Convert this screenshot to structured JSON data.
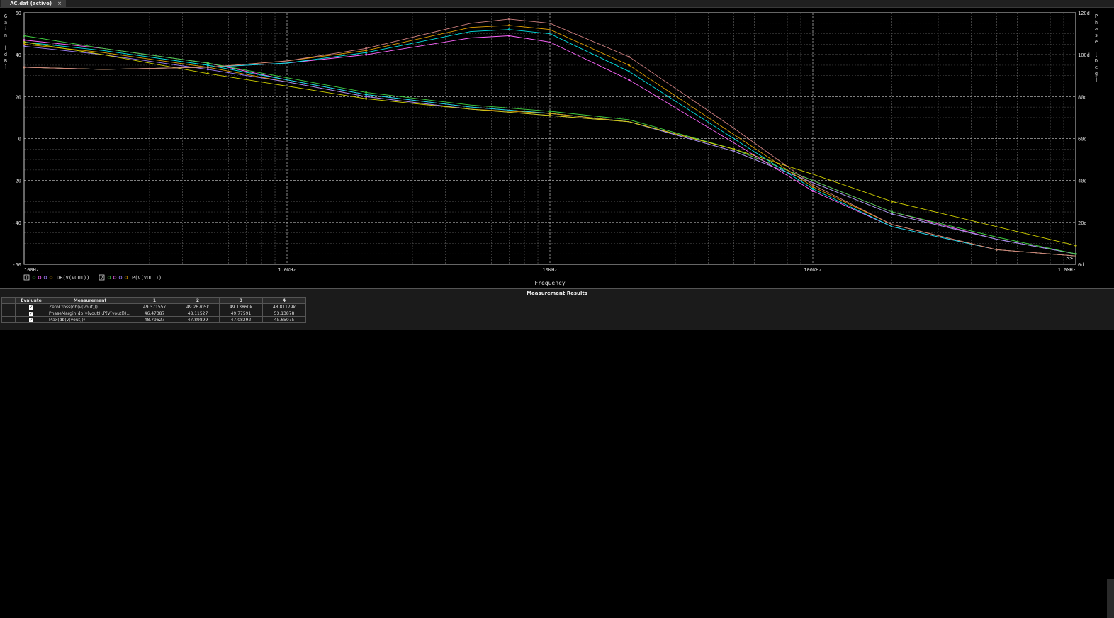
{
  "tab": {
    "title": "AC.dat (active)",
    "close": "×"
  },
  "chart_data": {
    "type": "line",
    "xscale": "log",
    "xlim": [
      100,
      1000000
    ],
    "x_ticks": [
      "100Hz",
      "1.0KHz",
      "10KHz",
      "100KHz",
      "1.0MHz"
    ],
    "x_tick_values": [
      100,
      1000,
      10000,
      100000,
      1000000
    ],
    "xlabel": "Frequency",
    "ylabel_left": "Gain [dB]",
    "ylim_left": [
      -60,
      60
    ],
    "y_ticks_left": [
      "60",
      "40",
      "20",
      "0",
      "-20",
      "-40",
      "-60"
    ],
    "ylabel_right": "Phase [Deg]",
    "ylim_right": [
      0,
      120
    ],
    "y_ticks_right": [
      "120d",
      "100d",
      "80d",
      "60d",
      "40d",
      "20d",
      "0d"
    ],
    "grid": true,
    "legend": [
      {
        "box": "1",
        "label": "DB(V(VOUT))"
      },
      {
        "box": "2",
        "label": "P(V(VOUT))"
      }
    ],
    "overflow_marker": ">>",
    "series": [
      {
        "axis": "left",
        "color": "#ff66ff",
        "x": [
          100,
          200,
          500,
          1000,
          2000,
          5000,
          10000,
          20000,
          50000,
          100000,
          200000,
          500000,
          1000000
        ],
        "y": [
          47,
          43,
          36,
          28,
          21,
          15,
          12,
          8,
          -5,
          -20,
          -35,
          -48,
          -55
        ]
      },
      {
        "axis": "left",
        "color": "#00e5e5",
        "x": [
          100,
          200,
          500,
          1000,
          2000,
          5000,
          10000,
          20000,
          50000,
          100000,
          200000,
          500000,
          1000000
        ],
        "y": [
          46,
          42,
          35,
          28,
          21,
          15,
          12,
          8,
          -6,
          -21,
          -36,
          -48,
          -55
        ]
      },
      {
        "axis": "left",
        "color": "#e0a000",
        "x": [
          100,
          200,
          500,
          1000,
          2000,
          5000,
          10000,
          20000,
          50000,
          100000,
          200000,
          500000,
          1000000
        ],
        "y": [
          45,
          41,
          34,
          27,
          20,
          14,
          12,
          8,
          -6,
          -21,
          -36,
          -48,
          -55
        ]
      },
      {
        "axis": "left",
        "color": "#a080ff",
        "x": [
          100,
          200,
          500,
          1000,
          2000,
          5000,
          10000,
          20000,
          50000,
          100000,
          200000,
          500000,
          1000000
        ],
        "y": [
          44,
          40,
          33,
          27,
          20,
          14,
          11,
          8,
          -6,
          -21,
          -36,
          -48,
          -55
        ]
      },
      {
        "axis": "left",
        "color": "#40d040",
        "x": [
          100,
          200,
          500,
          1000,
          2000,
          5000,
          10000,
          20000,
          50000,
          100000,
          200000,
          500000,
          1000000
        ],
        "y": [
          49,
          43,
          36,
          29,
          22,
          16,
          13,
          9,
          -5,
          -20,
          -35,
          -47,
          -55
        ]
      },
      {
        "axis": "left",
        "color": "#d0d000",
        "x": [
          100,
          200,
          500,
          1000,
          2000,
          5000,
          10000,
          20000,
          50000,
          100000,
          200000,
          500000,
          1000000
        ],
        "y": [
          46,
          40,
          31,
          25,
          19,
          14,
          11,
          8,
          -5,
          -17,
          -30,
          -42,
          -51
        ]
      },
      {
        "axis": "right",
        "color": "#ff66ff",
        "x": [
          100,
          200,
          500,
          1000,
          2000,
          5000,
          7000,
          10000,
          20000,
          50000,
          100000,
          200000,
          500000,
          1000000
        ],
        "y": [
          94,
          93,
          94,
          96,
          100,
          108,
          109,
          106,
          88,
          58,
          35,
          18,
          7,
          4
        ]
      },
      {
        "axis": "right",
        "color": "#00e5e5",
        "x": [
          100,
          200,
          500,
          1000,
          2000,
          5000,
          7000,
          10000,
          20000,
          50000,
          100000,
          200000,
          500000,
          1000000
        ],
        "y": [
          94,
          93,
          94,
          96,
          101,
          111,
          112,
          110,
          92,
          60,
          36,
          18,
          7,
          4
        ]
      },
      {
        "axis": "right",
        "color": "#e0a000",
        "x": [
          100,
          200,
          500,
          1000,
          2000,
          5000,
          7000,
          10000,
          20000,
          50000,
          100000,
          200000,
          500000,
          1000000
        ],
        "y": [
          94,
          93,
          94,
          97,
          102,
          113,
          114,
          112,
          95,
          62,
          37,
          19,
          7,
          4
        ]
      },
      {
        "axis": "right",
        "color": "#d08080",
        "x": [
          100,
          200,
          500,
          1000,
          2000,
          5000,
          7000,
          10000,
          20000,
          50000,
          100000,
          200000,
          500000,
          1000000
        ],
        "y": [
          94,
          93,
          94,
          97,
          103,
          115,
          117,
          115,
          99,
          65,
          38,
          19,
          7,
          4
        ]
      }
    ]
  },
  "measurements": {
    "title": "Measurement Results",
    "headers": [
      "Evaluate",
      "Measurement",
      "1",
      "2",
      "3",
      "4"
    ],
    "rows": [
      {
        "name": "ZeroCross(db(v(vout)))",
        "values": [
          "49.37155k",
          "49.26705k",
          "49.13860k",
          "48.81179k"
        ]
      },
      {
        "name": "PhaseMargin(db(v(vout)),P(V(vout)))...",
        "values": [
          "46.47387",
          "48.11527",
          "49.77591",
          "53.13878"
        ]
      },
      {
        "name": "Max(db(v(vout)))",
        "values": [
          "48.79627",
          "47.89899",
          "47.08292",
          "45.65075"
        ]
      }
    ]
  }
}
